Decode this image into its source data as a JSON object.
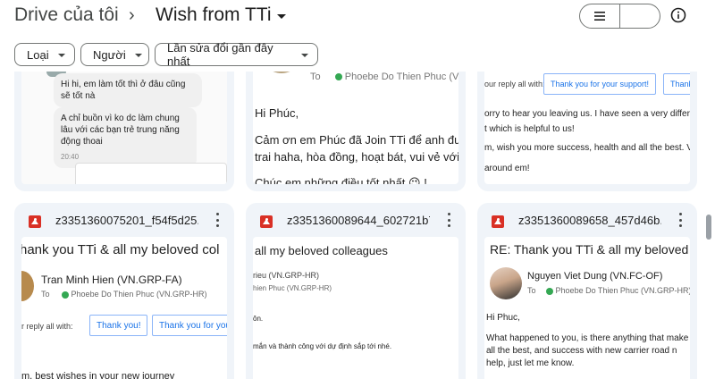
{
  "breadcrumb": {
    "root": "Drive của tôi",
    "separator": "›",
    "current": "Wish from TTi"
  },
  "filters": [
    {
      "label": "Loại"
    },
    {
      "label": "Người"
    },
    {
      "label": "Lần sửa đổi gần đây nhất"
    }
  ],
  "top_row": {
    "chat": {
      "bubble1": "Hi hi, em làm tốt thì ở đâu cũng sẽ tốt nà",
      "bubble2": "A chỉ buồn vì ko dc làm chung lâu với các bạn trẻ trung năng động thoai",
      "time": "20:40"
    },
    "mail1": {
      "to": "To",
      "recipient": "Phoebe Do Thien Phuc (VN",
      "greeting": "Hi Phúc,",
      "line1": "Cảm ơn em Phúc đã Join TTi để anh được",
      "line2": "trai haha, hòa đồng, hoạt bát, vui vẻ với",
      "line3": "Chúc em những điều tốt nhất 😉 !"
    },
    "mail2": {
      "reply_prompt": "our reply all with:",
      "reply_btn1": "Thank you for your support!",
      "reply_btn2": "Thank",
      "line1": "orry to hear you leaving us.  I have seen a very differ",
      "line2": "t which is helpful to us!",
      "line3": "m, wish you more success, health and all the best. V",
      "line4": "around em!"
    }
  },
  "files": [
    {
      "name": "z3351360075201_f54f5d25...",
      "subject": "hank you TTi & all my beloved col",
      "sender": "Tran Minh Hien (VN.GRP-FA)",
      "to": "To",
      "recipient": "Phoebe Do Thien Phuc (VN.GRP-HR)",
      "reply_prompt": "r reply all with:",
      "reply_btn1": "Thank you!",
      "reply_btn2": "Thank you for you",
      "body": "m, best wishes in your new journey"
    },
    {
      "name": "z3351360089644_602721b7...",
      "subject": "all my beloved colleagues",
      "sender": "rieu (VN.GRP-HR)",
      "recipient": "hien Phuc (VN.GRP-HR)",
      "line1": "ôn.",
      "line2": "mắn và thành công với dự định sắp tới nhé."
    },
    {
      "name": "z3351360089658_457d46b...",
      "subject": "RE: Thank you TTi & all my beloved c",
      "sender": "Nguyen Viet Dung (VN.FC-OF)",
      "to": "To",
      "recipient": "Phoebe Do Thien Phuc (VN.GRP-HR)",
      "greeting": "Hi Phuc,",
      "line1": "What happened to you, is there anything that make",
      "line2": "all the best, and success with new carrier road n",
      "line3": "help, just let me know."
    }
  ],
  "colors": {
    "card_bg": "#f0f4f9",
    "selected_view": "#c2e7ff",
    "pdf_red": "#d93025",
    "link_blue": "#1a73e8"
  }
}
